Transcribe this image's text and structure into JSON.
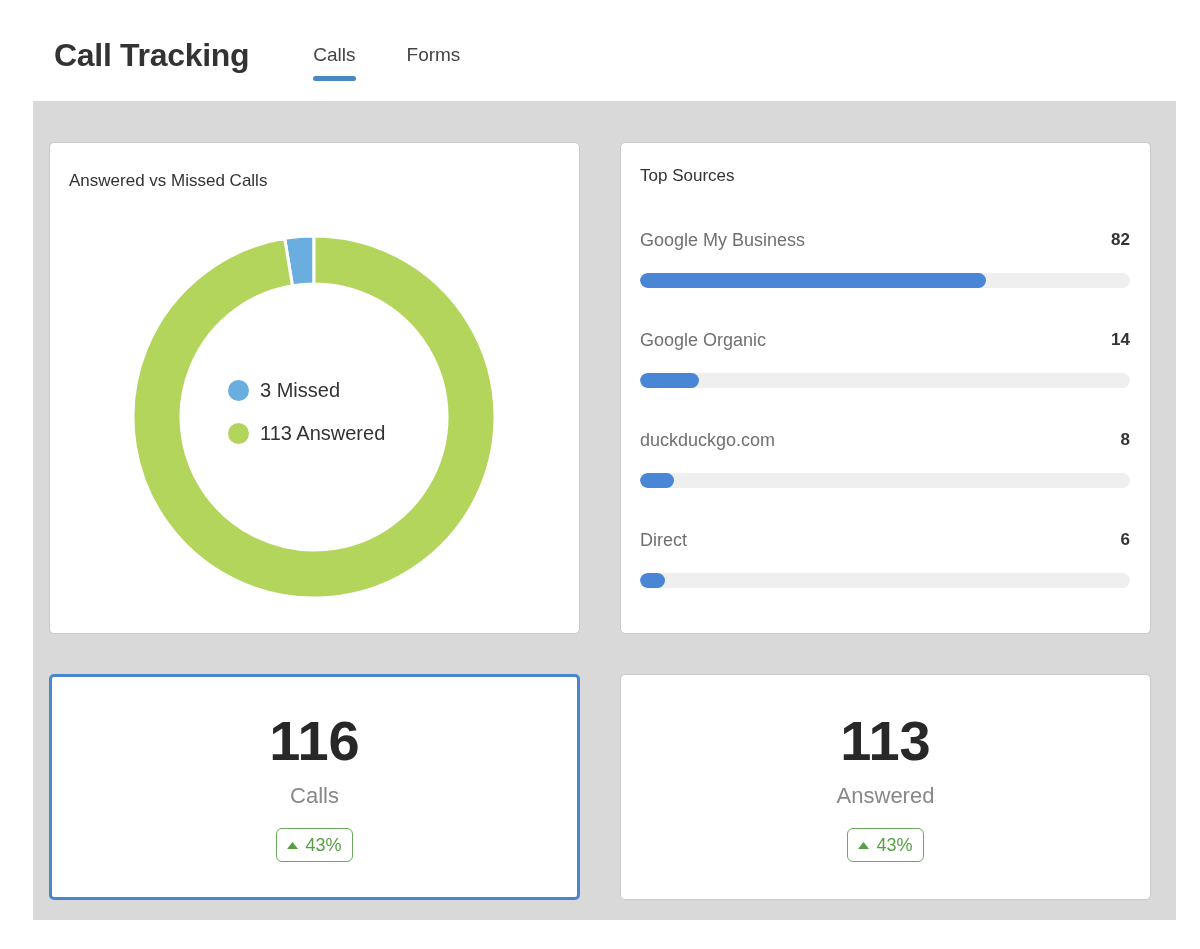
{
  "header": {
    "title": "Call Tracking",
    "tabs": [
      {
        "label": "Calls",
        "selected": true
      },
      {
        "label": "Forms",
        "selected": false
      }
    ]
  },
  "answered_vs_missed": {
    "legend": [
      {
        "label": "3 Missed",
        "color": "#6aaee0"
      },
      {
        "label": "113 Answered",
        "color": "#b4d55c"
      }
    ],
    "chart_data": {
      "type": "donut",
      "title": "Answered vs Missed Calls",
      "values": [
        2.59,
        97.41
      ]
    }
  },
  "top_sources": {
    "title": "Top Sources",
    "rows": [
      {
        "name": "Google My Business",
        "count": "82",
        "level": 0.707
      },
      {
        "name": "Google Organic",
        "count": "14",
        "level": 0.121
      },
      {
        "name": "duckduckgo.com",
        "count": "8",
        "level": 0.069
      },
      {
        "name": "Direct",
        "count": "6",
        "level": 0.052
      }
    ]
  },
  "stats": [
    {
      "value": "116",
      "label": "Calls",
      "change": "43%",
      "rising": true,
      "selected": true
    },
    {
      "value": "113",
      "label": "Answered",
      "change": "43%",
      "rising": true,
      "selected": false
    }
  ]
}
